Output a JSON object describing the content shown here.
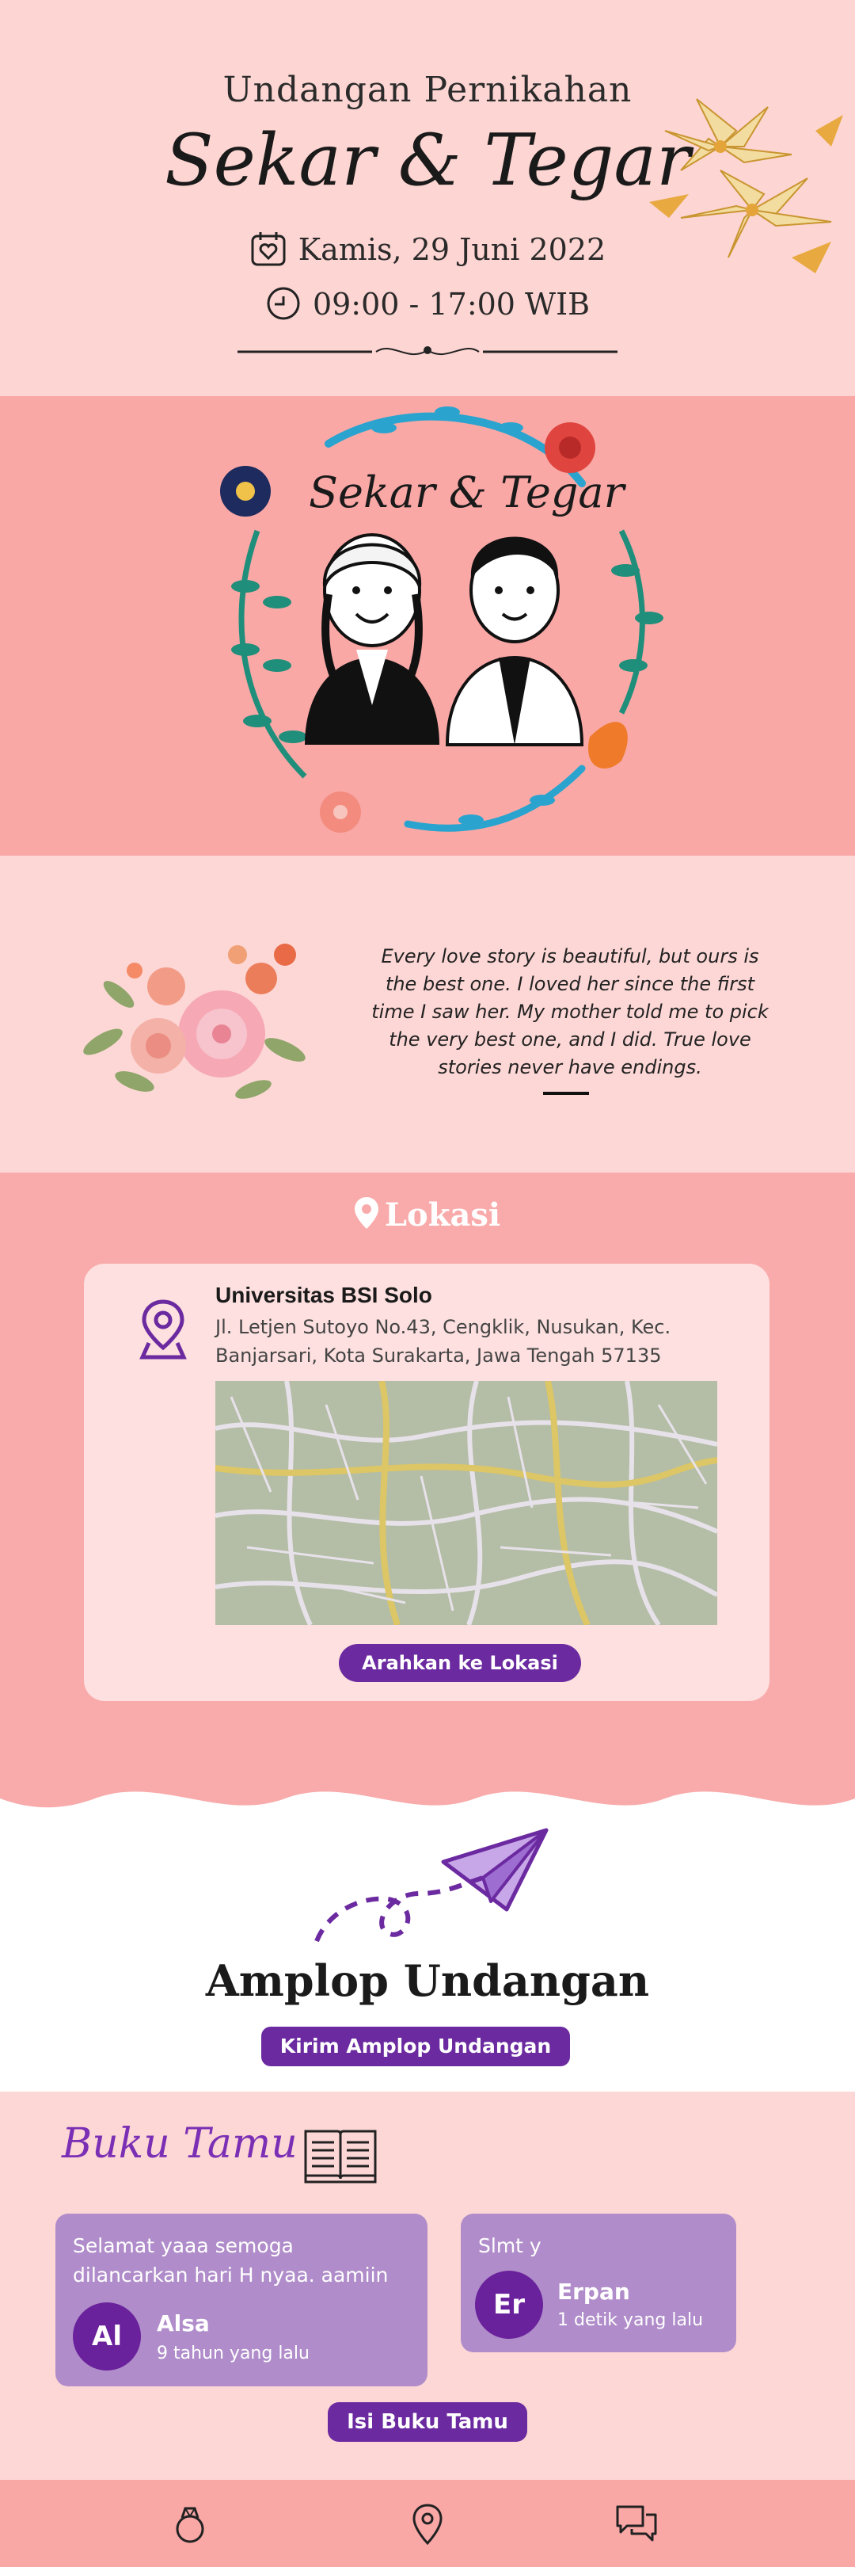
{
  "hero": {
    "subtitle": "Undangan Pernikahan",
    "names": "Sekar & Tegar",
    "date": "Kamis, 29 Juni 2022",
    "time": "09:00 - 17:00 WIB"
  },
  "couple": {
    "title": "Sekar & Tegar"
  },
  "quote": {
    "text": "Every love story is beautiful, but ours is the best one. I loved her since the first time I saw her. My mother told me to pick the very best one, and I did. True love stories never have endings."
  },
  "lokasi": {
    "title": "Lokasi",
    "venue": "Universitas BSI Solo",
    "address": "Jl. Letjen Sutoyo No.43, Cengklik, Nusukan, Kec. Banjarsari, Kota Surakarta, Jawa Tengah 57135",
    "button": "Arahkan ke Lokasi"
  },
  "amplop": {
    "title": "Amplop Undangan",
    "button": "Kirim Amplop Undangan"
  },
  "tamu": {
    "title": "Buku Tamu",
    "entries": [
      {
        "message": "Selamat yaaa semoga dilancarkan hari H nyaa. aamiin",
        "initials": "Al",
        "name": "Alsa",
        "time": "9 tahun yang lalu"
      },
      {
        "message": "Slmt y",
        "initials": "Er",
        "name": "Erpan",
        "time": "1 detik yang lalu"
      }
    ],
    "button": "Isi Buku Tamu"
  },
  "nav": {
    "items": [
      "ring-icon",
      "location-pin-icon",
      "chat-icon"
    ]
  },
  "colors": {
    "accent": "#6b2aa0",
    "hero_bg": "#fdd5d2",
    "salmon": "#f9a8a6",
    "card": "#b08dca"
  }
}
